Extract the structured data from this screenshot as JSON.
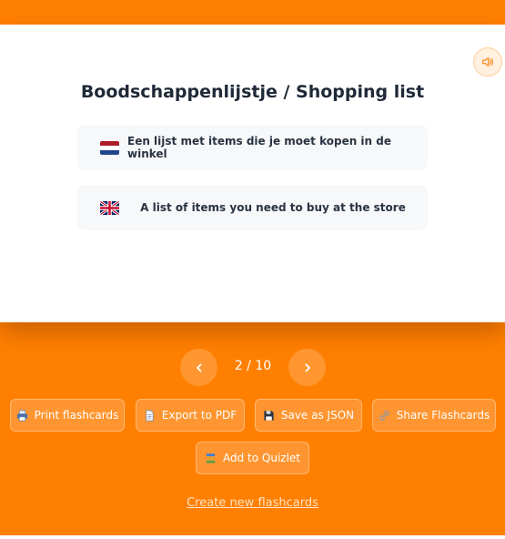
{
  "card": {
    "title": "Boodschappenlijstje / Shopping list",
    "phrases": [
      {
        "lang": "nl",
        "flag": "netherlands-flag",
        "text": "Een lijst met items die je moet kopen in de winkel"
      },
      {
        "lang": "en",
        "flag": "uk-flag",
        "text": "A list of items you need to buy at the store"
      }
    ],
    "speaker_icon": "speaker-icon"
  },
  "nav": {
    "counter": "2 / 10",
    "prev_icon": "chevron-left-icon",
    "next_icon": "chevron-right-icon"
  },
  "actions": {
    "print": "Print flashcards",
    "export_pdf": "Export to PDF",
    "save_json": "Save as JSON",
    "share": "Share Flashcards",
    "quizlet": "Add to Quizlet"
  },
  "create_link": "Create new flashcards",
  "colors": {
    "background": "#ff7f00",
    "card": "#ffffff",
    "accent": "#ff962f"
  }
}
